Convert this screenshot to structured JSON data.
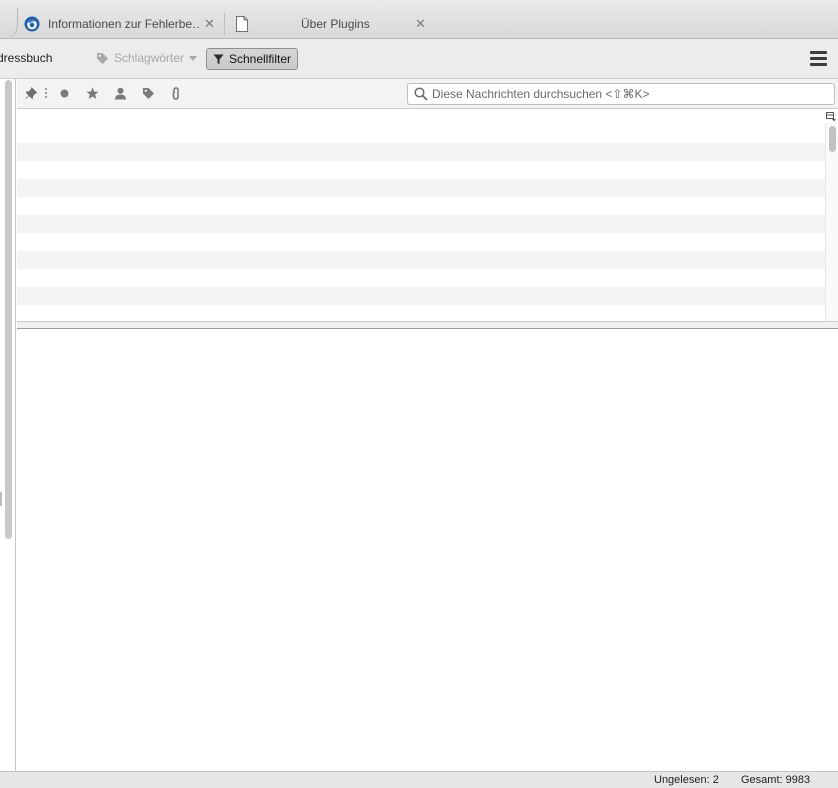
{
  "tabs": [
    {
      "label": "Informationen zur Fehlerbe…",
      "icon": "thunderbird-icon",
      "close_label": "✕"
    },
    {
      "label": "Über Plugins",
      "icon": "document-icon",
      "close_label": "✕"
    }
  ],
  "toolbar": {
    "address_book_label": "dressbuch",
    "tags_label": "Schlagwörter",
    "quick_filter_label": "Schnellfilter",
    "menu_icon": "hamburger-menu-icon"
  },
  "quick_filter": {
    "toggles": [
      "pin-icon",
      "unread-dot-icon",
      "star-icon",
      "contact-icon",
      "tag-icon",
      "attachment-icon"
    ],
    "search_placeholder": "Diese Nachrichten durchsuchen <⇧⌘K>"
  },
  "status": {
    "unread": "Ungelesen: 2",
    "total": "Gesamt: 9983"
  },
  "colors": {
    "accent": "#0a84ff",
    "toolbar_bg": "#ececec",
    "alt_row": "#f4f4f4"
  }
}
